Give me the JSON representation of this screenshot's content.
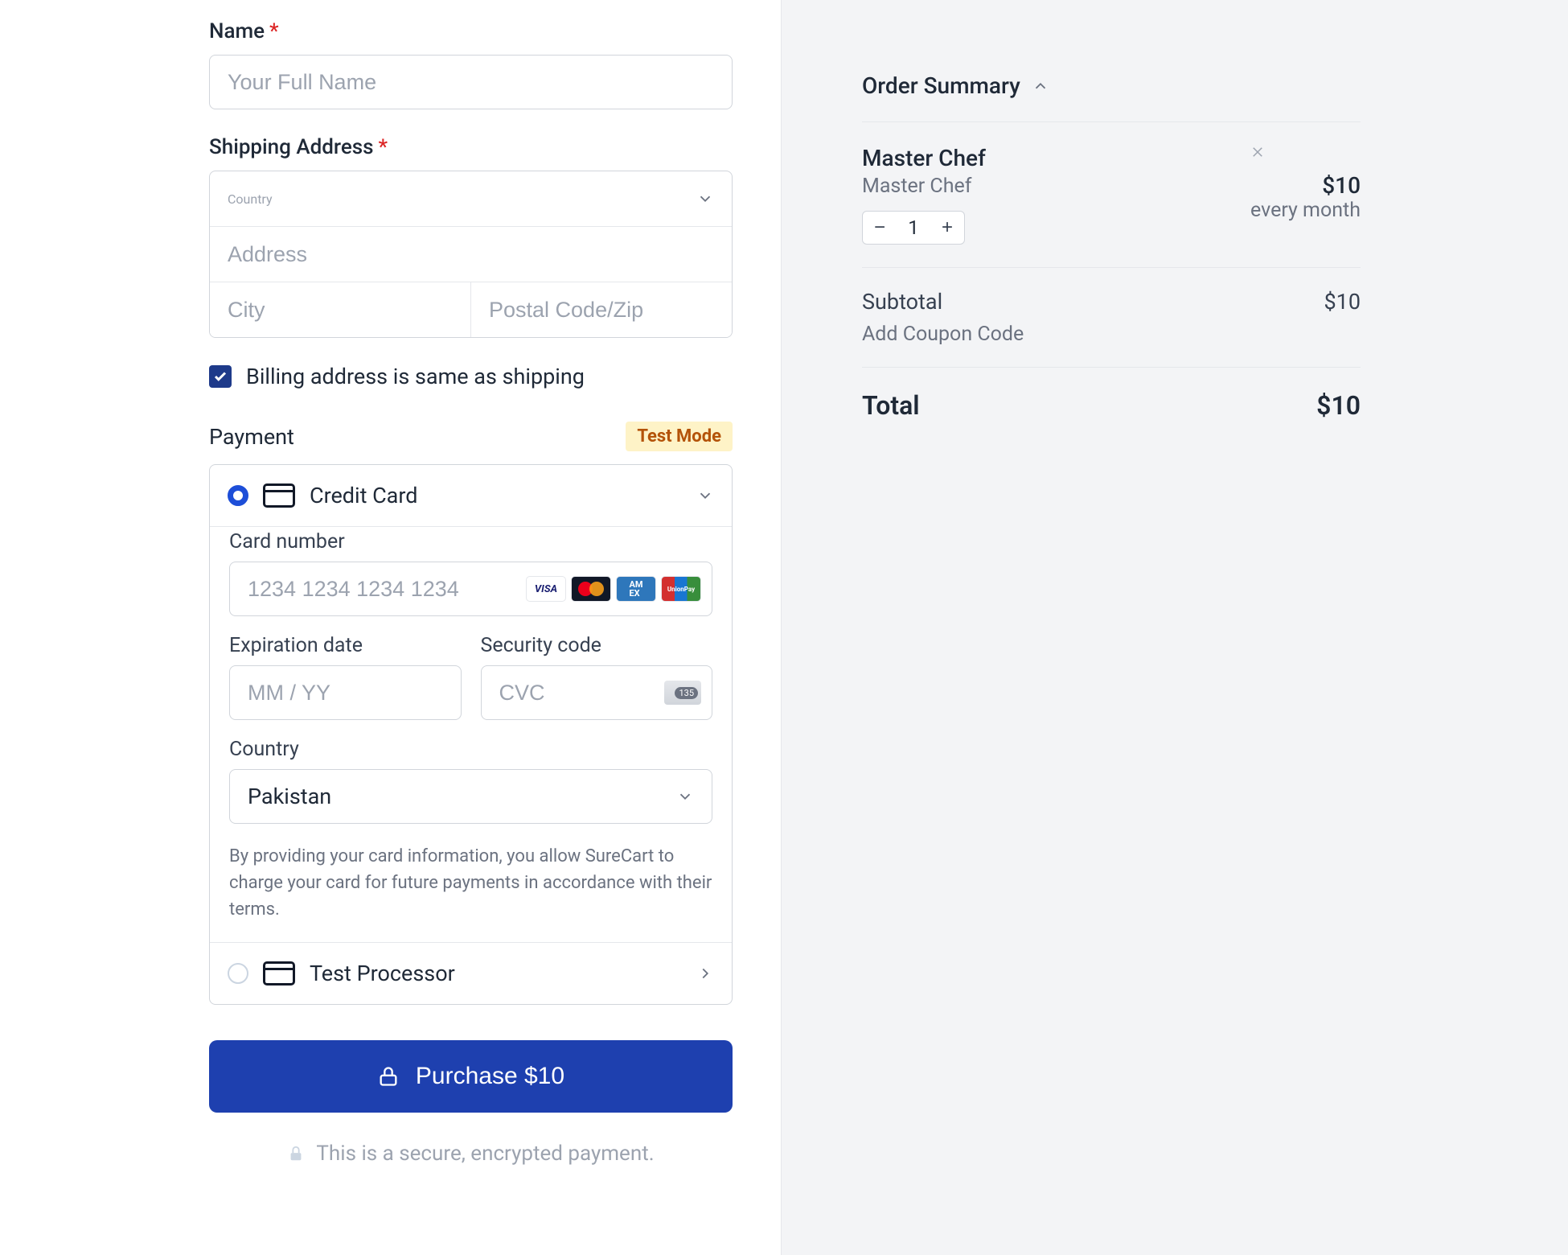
{
  "form": {
    "name_label": "Name",
    "name_placeholder": "Your Full Name",
    "shipping_label": "Shipping Address",
    "country_placeholder": "Country",
    "address_placeholder": "Address",
    "city_placeholder": "City",
    "postal_placeholder": "Postal Code/Zip",
    "billing_same_label": "Billing address is same as shipping",
    "payment_label": "Payment",
    "test_mode_badge": "Test Mode",
    "credit_card_label": "Credit Card",
    "card_number_label": "Card number",
    "card_number_placeholder": "1234 1234 1234 1234",
    "exp_label": "Expiration date",
    "exp_placeholder": "MM / YY",
    "cvc_label": "Security code",
    "cvc_placeholder": "CVC",
    "pay_country_label": "Country",
    "pay_country_value": "Pakistan",
    "terms_text": "By providing your card information, you allow SureCart to charge your card for future payments in accordance with their terms.",
    "test_processor_label": "Test Processor",
    "purchase_button": "Purchase $10",
    "secure_text": "This is a secure, encrypted payment.",
    "card_brands": {
      "visa": "VISA",
      "amex": "AM\nEX",
      "unionpay": "UnionPay"
    }
  },
  "summary": {
    "title": "Order Summary",
    "item": {
      "title": "Master Chef",
      "subtitle": "Master Chef",
      "price": "$10",
      "period": "every month",
      "quantity": "1"
    },
    "subtotal_label": "Subtotal",
    "subtotal_value": "$10",
    "coupon_link": "Add Coupon Code",
    "total_label": "Total",
    "total_value": "$10"
  }
}
